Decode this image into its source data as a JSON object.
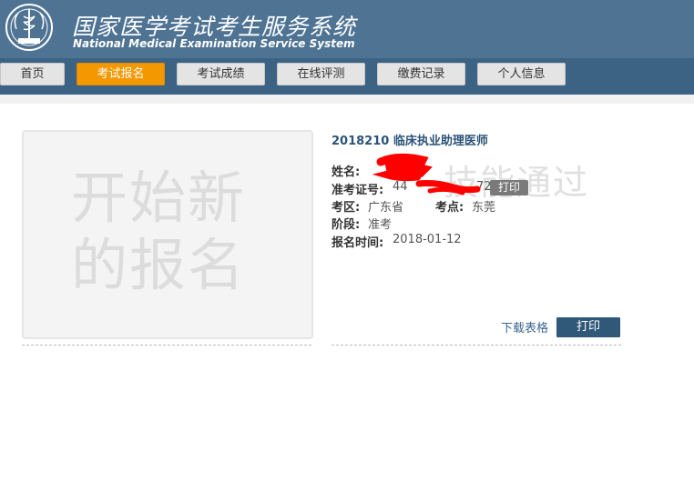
{
  "header": {
    "title_cn": "国家医学考试考生服务系统",
    "title_en": "National Medical Examination Service System",
    "logo_icon": "medical-emblem-icon"
  },
  "nav": {
    "items": [
      {
        "label": "首页"
      },
      {
        "label": "考试报名"
      },
      {
        "label": "考试成绩"
      },
      {
        "label": "在线评测"
      },
      {
        "label": "缴费记录"
      },
      {
        "label": "个人信息"
      }
    ],
    "active_index": 1
  },
  "new_registration": {
    "line1": "开始新",
    "line2": "的报名"
  },
  "registration": {
    "exam_title": "2018210 临床执业助理医师",
    "name_label": "姓名:",
    "name_value": "",
    "admission_label": "准考证号:",
    "admission_value_start": "44",
    "admission_value_end": "72",
    "print_small": "打印",
    "region_label": "考区:",
    "region_value": "广东省",
    "site_label": "考点:",
    "site_value": "东莞",
    "stage_label": "阶段:",
    "stage_value": "准考",
    "time_label": "报名时间:",
    "time_value": "2018-01-12",
    "watermark": "技能通过",
    "download_label": "下载表格",
    "print_label": "打印"
  },
  "colors": {
    "header_bg": "#4e7393",
    "nav_bg": "#3d6384",
    "active_tab": "#f39800",
    "primary_button": "#2f5879",
    "redaction": "#ff0000"
  }
}
